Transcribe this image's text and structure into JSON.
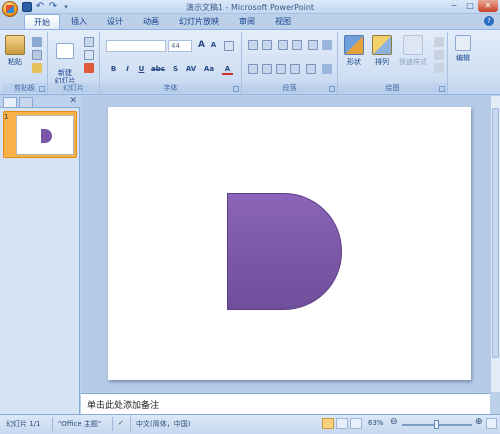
{
  "window": {
    "title": "演示文稿1 - Microsoft PowerPoint",
    "min": "−",
    "restore": "□",
    "close": "✕"
  },
  "tabs": [
    "开始",
    "插入",
    "设计",
    "动画",
    "幻灯片放映",
    "审阅",
    "视图"
  ],
  "ribbon": {
    "clipboard": {
      "label": "剪贴板",
      "paste": "粘贴"
    },
    "slides": {
      "label": "幻灯片",
      "new_slide": "新建\n幻灯片"
    },
    "font": {
      "label": "字体",
      "font_size": "44",
      "bold": "B",
      "italic": "I",
      "underline": "U",
      "strike": "abc",
      "shadow": "S",
      "spacing": "AV",
      "case": "Aa",
      "color": "A",
      "grow": "A",
      "shrink": "A"
    },
    "paragraph": {
      "label": "段落"
    },
    "drawing": {
      "label": "绘图",
      "shapes": "形状",
      "arrange": "排列",
      "quick_styles": "快速样式"
    },
    "editing": {
      "label": "编辑"
    }
  },
  "left_panel": {
    "slide_number": "1"
  },
  "notes": {
    "placeholder": "单击此处添加备注"
  },
  "status": {
    "slide_info": "幻灯片 1/1",
    "theme": "\"Office 主题\"",
    "language": "中文(简体，中国)",
    "zoom": "63%"
  },
  "colors": {
    "shape_fill": "#7a55a5",
    "ribbon_bg": "#d3e1f4",
    "accent": "#15428b"
  }
}
